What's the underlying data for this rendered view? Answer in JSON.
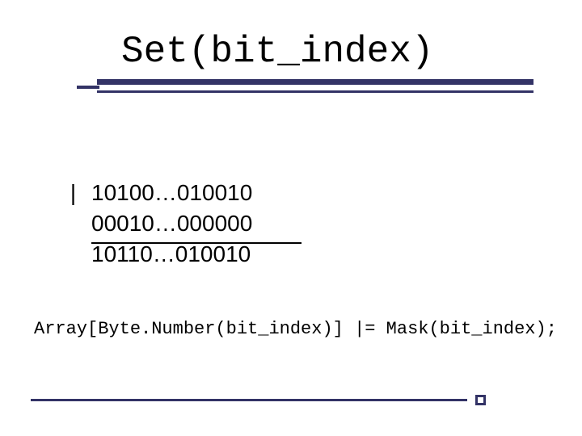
{
  "title": "Set(bit_index)",
  "bits": {
    "operator": "|",
    "line1": "10100…010010",
    "line2": "00010…000000",
    "result": "10110…010010"
  },
  "code": "Array[Byte.Number(bit_index)] |= Mask(bit_index);",
  "colors": {
    "accent": "#333366"
  }
}
